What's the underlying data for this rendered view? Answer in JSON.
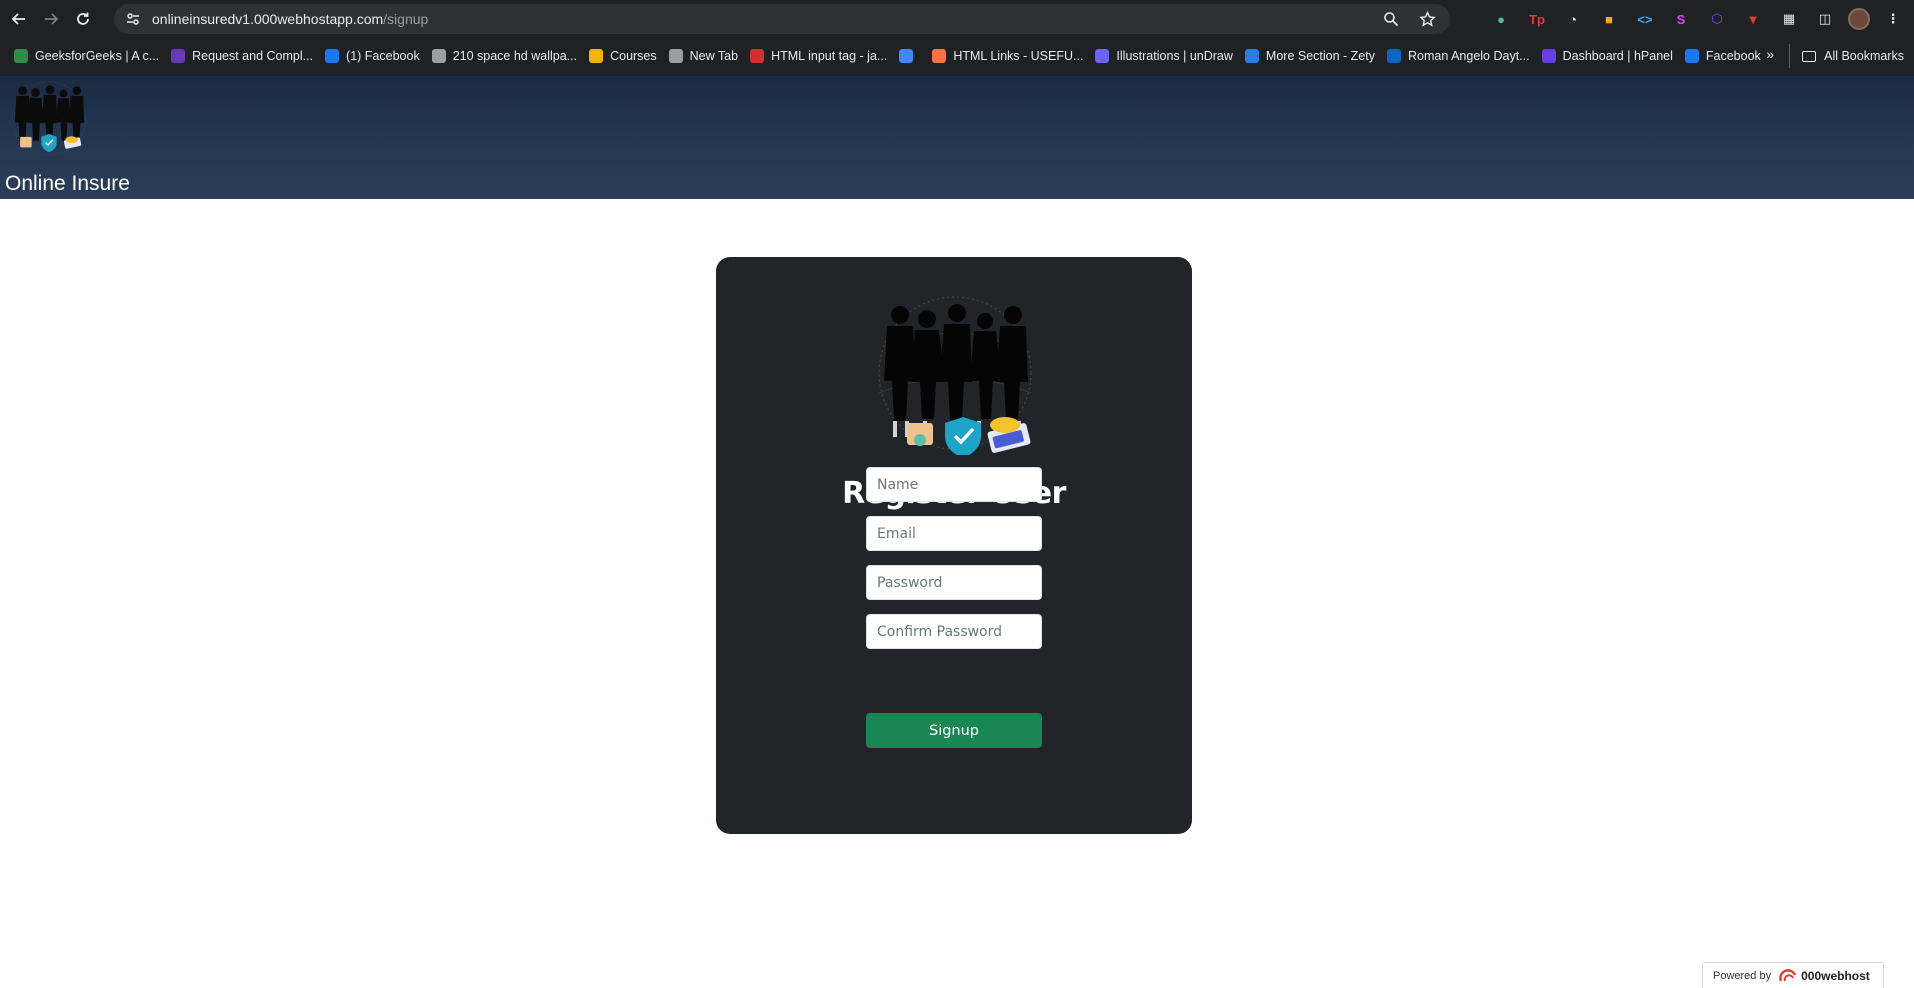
{
  "browser": {
    "url_host": "onlineinsuredv1.000webhostapp.com",
    "url_path": "/signup",
    "bookmarks": [
      {
        "label": "GeeksforGeeks | A c...",
        "icon": "geeksforgeeks-icon",
        "color": "#2f8d46"
      },
      {
        "label": "Request and Compl...",
        "icon": "forms-icon",
        "color": "#673ab7"
      },
      {
        "label": "(1) Facebook",
        "icon": "facebook-icon",
        "color": "#1877f2"
      },
      {
        "label": "210 space hd wallpa...",
        "icon": "globe-icon",
        "color": "#9aa0a6"
      },
      {
        "label": "Courses",
        "icon": "classroom-icon",
        "color": "#f4b400"
      },
      {
        "label": "New Tab",
        "icon": "globe-icon",
        "color": "#9aa0a6"
      },
      {
        "label": "HTML input tag - ja...",
        "icon": "javatpoint-icon",
        "color": "#d32f2f"
      },
      {
        "label": "",
        "icon": "calendar-icon",
        "color": "#4285f4"
      },
      {
        "label": "HTML Links - USEFU...",
        "icon": "links-icon",
        "color": "#ff7043"
      },
      {
        "label": "Illustrations | unDraw",
        "icon": "undraw-icon",
        "color": "#6c63ff"
      },
      {
        "label": "More Section - Zety",
        "icon": "zety-icon",
        "color": "#2a7de1"
      },
      {
        "label": "Roman Angelo Dayt...",
        "icon": "linkedin-icon",
        "color": "#0a66c2"
      },
      {
        "label": "Dashboard | hPanel",
        "icon": "hostinger-icon",
        "color": "#673de6"
      },
      {
        "label": "Facebook",
        "icon": "facebook-icon",
        "color": "#1877f2"
      }
    ],
    "all_bookmarks": "All Bookmarks"
  },
  "header": {
    "site_name": "Online Insure"
  },
  "form": {
    "title": "Register User",
    "name_placeholder": "Name",
    "email_placeholder": "Email",
    "password_placeholder": "Password",
    "confirm_placeholder": "Confirm Password",
    "submit_label": "Signup"
  },
  "footer": {
    "powered_by": "Powered by",
    "host_brand": "000webhost"
  },
  "colors": {
    "header_bg": "#253752",
    "card_bg": "#212529",
    "button_bg": "#198754"
  }
}
